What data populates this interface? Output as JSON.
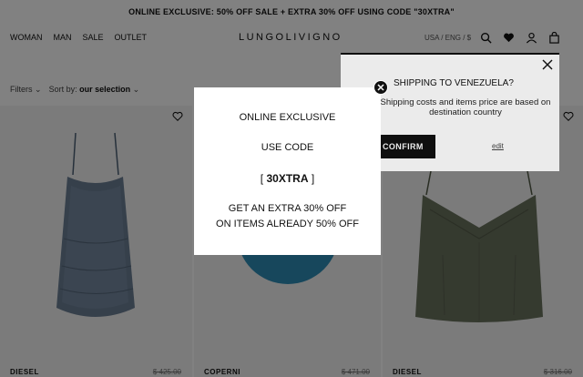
{
  "promo": {
    "text": "ONLINE EXCLUSIVE: 50% OFF SALE + EXTRA 30% OFF USING CODE \"30XTRA\""
  },
  "nav": {
    "items": [
      "WOMAN",
      "MAN",
      "SALE",
      "OUTLET"
    ]
  },
  "logo": "LUNGOLIVIGNO",
  "locale": "USA / ENG / $",
  "header_icons": [
    "search-icon",
    "heart-icon",
    "user-icon",
    "bag-icon"
  ],
  "filters": {
    "filters_label": "Filters",
    "sort_prefix": "Sort by:",
    "sort_value": "our selection"
  },
  "products": [
    {
      "brand": "DIESEL",
      "price": "$ 425.00"
    },
    {
      "brand": "COPERNI",
      "price": "$ 471.00"
    },
    {
      "brand": "DIESEL",
      "price": "$ 316.00"
    }
  ],
  "shipping": {
    "title": "SHIPPING TO VENEZUELA?",
    "text": "Shipping costs and items price are based on destination country",
    "confirm": "CONFIRM",
    "edit": "edit"
  },
  "modal": {
    "line1": "ONLINE EXCLUSIVE",
    "line2": "USE CODE",
    "code_open": "[",
    "code": "30XTRA",
    "code_close": "]",
    "line4": "GET AN EXTRA 30% OFF",
    "line5": "ON ITEMS ALREADY 50% OFF"
  },
  "colors": {
    "accent": "#111111",
    "overlay": "#000000"
  }
}
